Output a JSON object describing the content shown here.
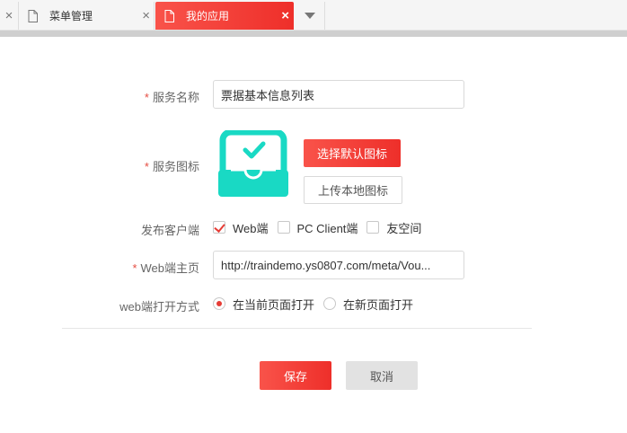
{
  "tabs": {
    "close_glyph": "×",
    "items": [
      {
        "label": "菜单管理",
        "active": false
      },
      {
        "label": "我的应用",
        "active": true
      }
    ],
    "more_icon": "caret-down-icon"
  },
  "form": {
    "service_name": {
      "required_mark": "*",
      "label": "服务名称",
      "value": "票据基本信息列表"
    },
    "service_icon": {
      "required_mark": "*",
      "label": "服务图标",
      "icon": "tray-check-icon",
      "icon_color": "#19d9c4",
      "choose_default_label": "选择默认图标",
      "upload_local_label": "上传本地图标"
    },
    "publish_client": {
      "label": "发布客户端",
      "options": [
        {
          "label": "Web端",
          "checked": true
        },
        {
          "label": "PC Client端",
          "checked": false
        },
        {
          "label": "友空间",
          "checked": false
        }
      ]
    },
    "web_home": {
      "required_mark": "*",
      "label": "Web端主页",
      "value": "http://traindemo.ys0807.com/meta/Vou..."
    },
    "web_open_mode": {
      "label": "web端打开方式",
      "options": [
        {
          "label": "在当前页面打开",
          "checked": true
        },
        {
          "label": "在新页面打开",
          "checked": false
        }
      ]
    }
  },
  "actions": {
    "save_label": "保存",
    "cancel_label": "取消"
  },
  "colors": {
    "accent": "#ee2f2a",
    "required": "#e54d42",
    "icon_teal": "#19d9c4"
  }
}
